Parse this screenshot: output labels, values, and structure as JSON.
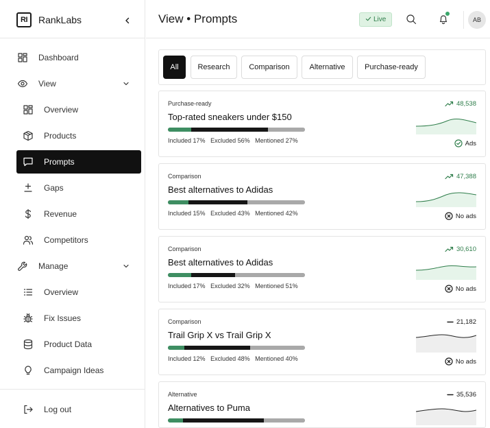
{
  "brand": {
    "logo_text": "RI",
    "name": "RankLabs"
  },
  "sidebar": {
    "items": [
      {
        "label": "Dashboard",
        "icon": "grid-icon"
      },
      {
        "label": "View",
        "icon": "eye-icon"
      },
      {
        "label": "Overview",
        "icon": "grid-icon"
      },
      {
        "label": "Products",
        "icon": "box-icon"
      },
      {
        "label": "Prompts",
        "icon": "chat-icon",
        "active": true
      },
      {
        "label": "Gaps",
        "icon": "plus-minus-icon"
      },
      {
        "label": "Revenue",
        "icon": "dollar-icon"
      },
      {
        "label": "Competitors",
        "icon": "users-icon"
      },
      {
        "label": "Manage",
        "icon": "wrench-icon"
      },
      {
        "label": "Overview",
        "icon": "list-icon"
      },
      {
        "label": "Fix Issues",
        "icon": "bug-icon"
      },
      {
        "label": "Product Data",
        "icon": "database-icon"
      },
      {
        "label": "Campaign Ideas",
        "icon": "lightbulb-icon"
      }
    ],
    "logout_label": "Log out"
  },
  "header": {
    "title": "View • Prompts",
    "live_label": "Live",
    "avatar_initials": "AB"
  },
  "filters": [
    "All",
    "Research",
    "Comparison",
    "Alternative",
    "Purchase-ready"
  ],
  "active_filter": "All",
  "colors": {
    "included": "#3e8e62",
    "excluded": "#161616",
    "mentioned": "#a9a9a9",
    "trend_up": "#2e7d4a"
  },
  "cards": [
    {
      "category": "Purchase-ready",
      "title": "Top-rated sneakers under $150",
      "included": 17,
      "excluded": 56,
      "mentioned": 27,
      "included_text": "Included 17%",
      "excluded_text": "Excluded 56%",
      "mentioned_text": "Mentioned 27%",
      "metric": "48,538",
      "trend": "up",
      "ads_label": "Ads",
      "ads": true
    },
    {
      "category": "Comparison",
      "title": "Best alternatives to Adidas",
      "included": 15,
      "excluded": 43,
      "mentioned": 42,
      "included_text": "Included 15%",
      "excluded_text": "Excluded 43%",
      "mentioned_text": "Mentioned 42%",
      "metric": "47,388",
      "trend": "up",
      "ads_label": "No ads",
      "ads": false
    },
    {
      "category": "Comparison",
      "title": "Best alternatives to Adidas",
      "included": 17,
      "excluded": 32,
      "mentioned": 51,
      "included_text": "Included 17%",
      "excluded_text": "Excluded 32%",
      "mentioned_text": "Mentioned 51%",
      "metric": "30,610",
      "trend": "up",
      "ads_label": "No ads",
      "ads": false
    },
    {
      "category": "Comparison",
      "title": "Trail Grip X vs Trail Grip X",
      "included": 12,
      "excluded": 48,
      "mentioned": 40,
      "included_text": "Included 12%",
      "excluded_text": "Excluded 48%",
      "mentioned_text": "Mentioned 40%",
      "metric": "21,182",
      "trend": "flat",
      "ads_label": "No ads",
      "ads": false
    },
    {
      "category": "Alternative",
      "title": "Alternatives to Puma",
      "included": 11,
      "excluded": 59,
      "mentioned": 30,
      "included_text": "",
      "excluded_text": "",
      "mentioned_text": "",
      "metric": "35,536",
      "trend": "flat",
      "ads_label": "",
      "ads": false
    }
  ]
}
